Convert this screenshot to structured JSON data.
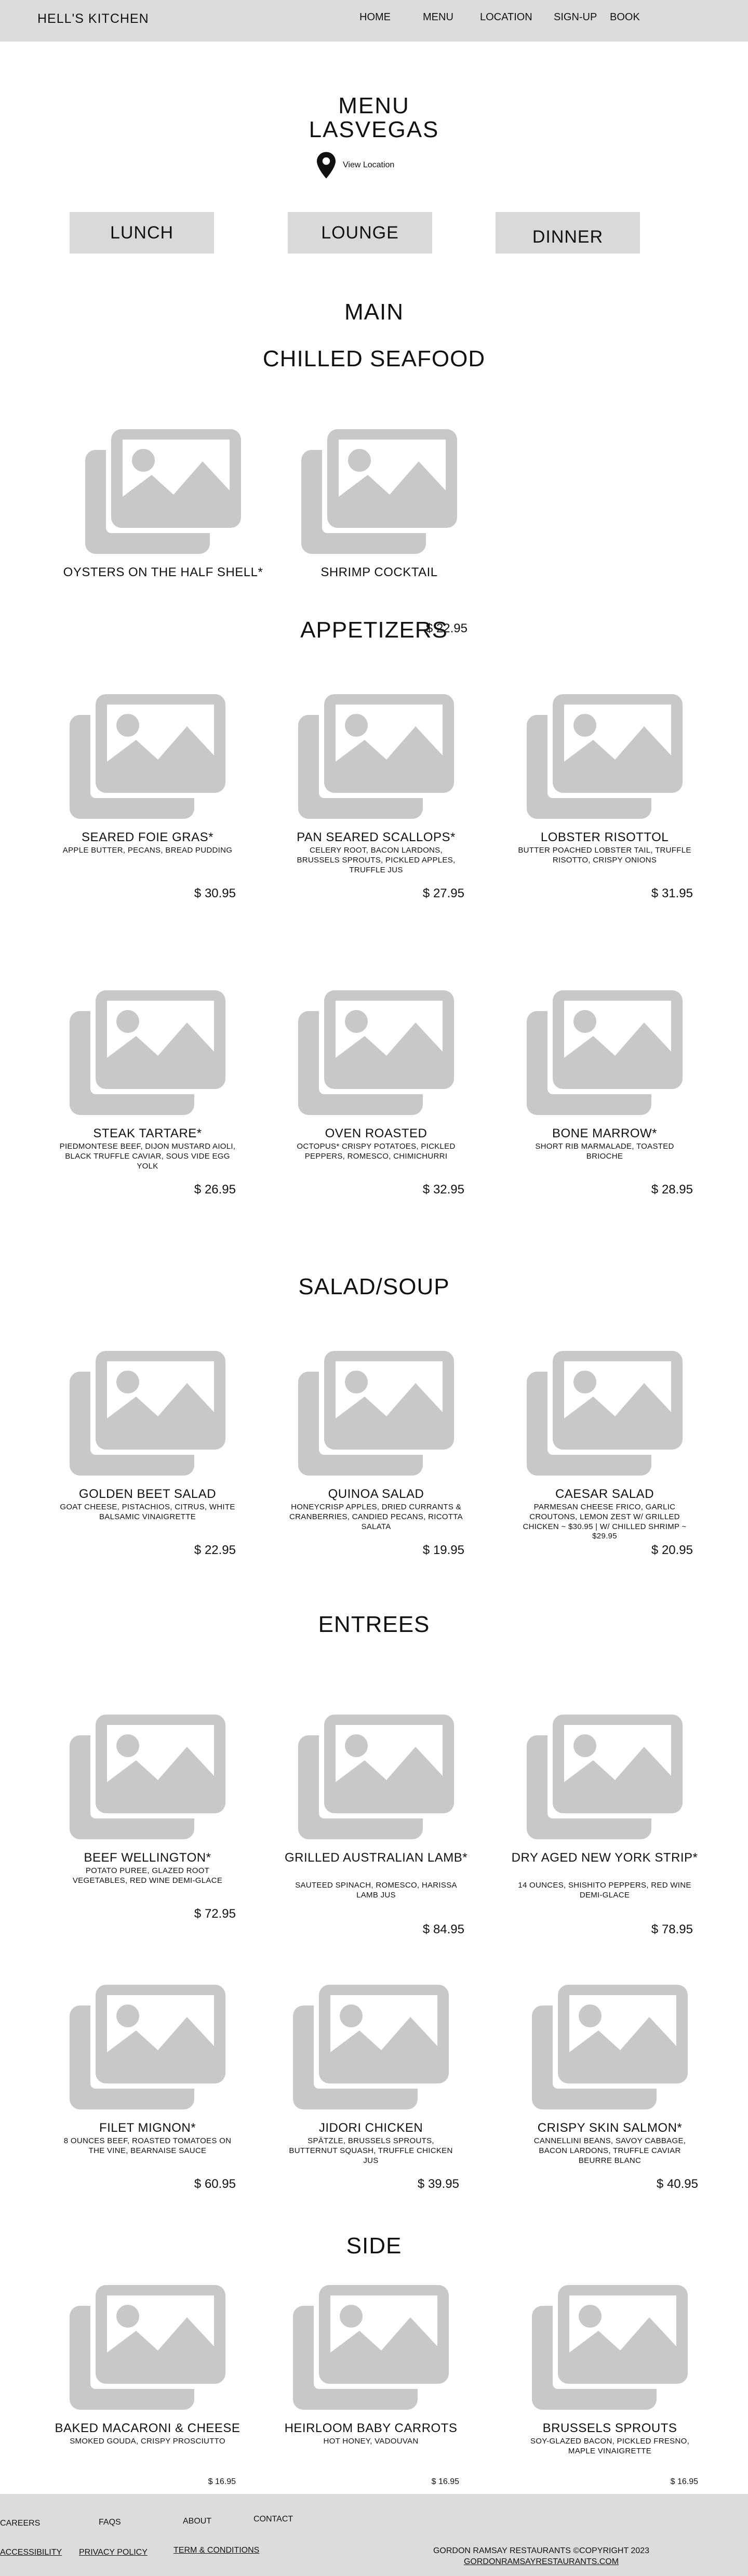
{
  "nav": {
    "brand": "HELL'S KITCHEN",
    "links": [
      "HOME",
      "MENU",
      "LOCATION",
      "SIGN-UP",
      "BOOK"
    ]
  },
  "header": {
    "title": "MENU",
    "subtitle": "LASVEGAS",
    "location_label": "View Location",
    "location_icon": "map-pin-icon"
  },
  "tabs": [
    "LUNCH",
    "LOUNGE",
    "DINNER"
  ],
  "sections": {
    "main": "MAIN",
    "chilled_seafood": "CHILLED SEAFOOD",
    "appetizers": "APPETIZERS",
    "salad_soup": "SALAD/SOUP",
    "entrees": "ENTREES",
    "side": "SIDE"
  },
  "chilled_seafood": [
    {
      "name": "OYSTERS ON THE HALF SHELL*",
      "desc": "",
      "price": ""
    },
    {
      "name": "SHRIMP COCKTAIL",
      "desc": "",
      "price": "$ 22.95"
    }
  ],
  "appetizers": [
    {
      "name": "SEARED FOIE GRAS*",
      "desc": "APPLE BUTTER, PECANS, BREAD PUDDING",
      "price": "$ 30.95"
    },
    {
      "name": "PAN SEARED SCALLOPS*",
      "desc": "CELERY ROOT, BACON LARDONS, BRUSSELS SPROUTS, PICKLED APPLES, TRUFFLE JUS",
      "price": "$ 27.95"
    },
    {
      "name": "LOBSTER RISOTTOL",
      "desc": "BUTTER POACHED LOBSTER TAIL, TRUFFLE RISOTTO, CRISPY ONIONS",
      "price": "$ 31.95"
    },
    {
      "name": "STEAK TARTARE*",
      "desc": "PIEDMONTESE BEEF, DIJON MUSTARD AIOLI, BLACK TRUFFLE CAVIAR, SOUS VIDE EGG YOLK",
      "price": "$ 26.95"
    },
    {
      "name": "OVEN ROASTED",
      "desc": "OCTOPUS* CRISPY POTATOES, PICKLED PEPPERS, ROMESCO, CHIMICHURRI",
      "price": "$ 32.95"
    },
    {
      "name": "BONE MARROW*",
      "desc": "SHORT RIB MARMALADE, TOASTED BRIOCHE",
      "price": "$ 28.95"
    }
  ],
  "salad_soup": [
    {
      "name": "GOLDEN BEET SALAD",
      "desc": "GOAT CHEESE, PISTACHIOS, CITRUS, WHITE BALSAMIC VINAIGRETTE",
      "price": "$ 22.95"
    },
    {
      "name": "QUINOA SALAD",
      "desc": "HONEYCRISP APPLES, DRIED CURRANTS & CRANBERRIES, CANDIED PECANS, RICOTTA SALATA",
      "price": "$ 19.95"
    },
    {
      "name": "CAESAR SALAD",
      "desc": "PARMESAN CHEESE FRICO, GARLIC CROUTONS, LEMON ZEST W/ GRILLED CHICKEN ~ $30.95 | W/ CHILLED SHRIMP ~ $29.95",
      "price": "$ 20.95"
    }
  ],
  "entrees": [
    {
      "name": "BEEF WELLINGTON*",
      "desc": "POTATO PUREE, GLAZED ROOT VEGETABLES, RED WINE DEMI-GLACE",
      "price": "$ 72.95"
    },
    {
      "name": "GRILLED AUSTRALIAN LAMB*",
      "desc": "SAUTEED SPINACH, ROMESCO, HARISSA LAMB JUS",
      "price": "$ 84.95"
    },
    {
      "name": "DRY AGED NEW YORK STRIP*",
      "desc": "14 OUNCES, SHISHITO PEPPERS, RED WINE DEMI-GLACE",
      "price": "$ 78.95"
    },
    {
      "name": "FILET MIGNON*",
      "desc": "8 OUNCES BEEF, ROASTED TOMATOES ON THE VINE, BEARNAISE SAUCE",
      "price": "$ 60.95"
    },
    {
      "name": "JIDORI CHICKEN",
      "desc": "SPÄTZLE, BRUSSELS SPROUTS, BUTTERNUT SQUASH, TRUFFLE CHICKEN JUS",
      "price": "$ 39.95"
    },
    {
      "name": "CRISPY SKIN SALMON*",
      "desc": "CANNELLINI BEANS, SAVOY CABBAGE, BACON LARDONS, TRUFFLE CAVIAR BEURRE BLANC",
      "price": "$ 40.95"
    }
  ],
  "side": [
    {
      "name": "BAKED MACARONI & CHEESE",
      "desc": "SMOKED GOUDA, CRISPY PROSCIUTTO",
      "price": "$ 16.95"
    },
    {
      "name": "HEIRLOOM BABY CARROTS",
      "desc": "HOT HONEY, VADOUVAN",
      "price": "$ 16.95"
    },
    {
      "name": "BRUSSELS SPROUTS",
      "desc": "SOY-GLAZED BACON, PICKLED FRESNO, MAPLE VINAIGRETTE",
      "price": "$ 16.95"
    }
  ],
  "footer": {
    "links": [
      "CAREERS",
      "FAQS",
      "ABOUT",
      "CONTACT"
    ],
    "legal": [
      "ACCESSIBILITY",
      "PRIVACY POLICY",
      "TERM & CONDITIONS"
    ],
    "copyright": "GORDON RAMSAY RESTAURANTS ©COPYRIGHT 2023",
    "site": "GORDONRAMSAYRESTAURANTS.COM"
  },
  "colors": {
    "bar": "#dcdcdc",
    "placeholder": "#c8c8c8"
  }
}
